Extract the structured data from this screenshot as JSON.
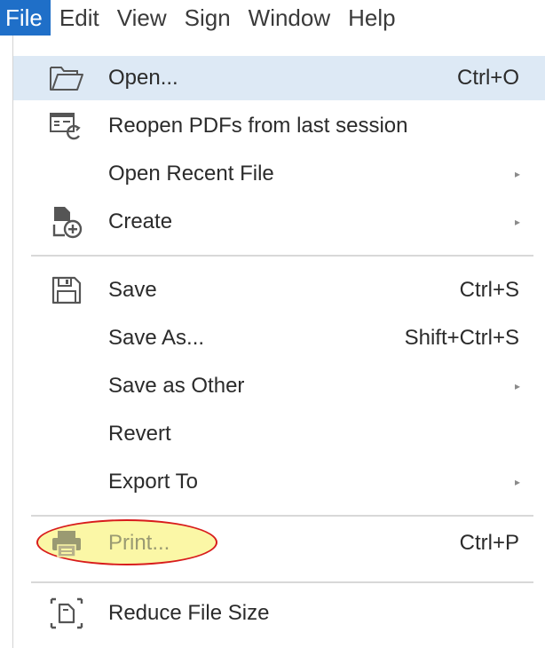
{
  "menubar": {
    "items": [
      {
        "label": "File",
        "active": true
      },
      {
        "label": "Edit"
      },
      {
        "label": "View"
      },
      {
        "label": "Sign"
      },
      {
        "label": "Window"
      },
      {
        "label": "Help"
      }
    ]
  },
  "menu": {
    "open": {
      "label": "Open...",
      "shortcut": "Ctrl+O",
      "icon": "folder-open-icon"
    },
    "reopen": {
      "label": "Reopen PDFs from last session",
      "icon": "reopen-session-icon"
    },
    "open_recent": {
      "label": "Open Recent File",
      "submenu": "▸"
    },
    "create": {
      "label": "Create",
      "submenu": "▸",
      "icon": "create-pdf-icon"
    },
    "save": {
      "label": "Save",
      "shortcut": "Ctrl+S",
      "icon": "save-icon"
    },
    "save_as": {
      "label": "Save As...",
      "shortcut": "Shift+Ctrl+S"
    },
    "save_other": {
      "label": "Save as Other",
      "submenu": "▸"
    },
    "revert": {
      "label": "Revert"
    },
    "export": {
      "label": "Export To",
      "submenu": "▸"
    },
    "print": {
      "label": "Print...",
      "shortcut": "Ctrl+P",
      "icon": "printer-icon"
    },
    "reduce": {
      "label": "Reduce File Size",
      "icon": "reduce-file-size-icon"
    }
  },
  "colors": {
    "menubar_active": "#1f6fc8",
    "hover_highlight": "#dde9f5",
    "annotation_fill": "#fbf7a6",
    "annotation_stroke": "#d81c1c"
  }
}
